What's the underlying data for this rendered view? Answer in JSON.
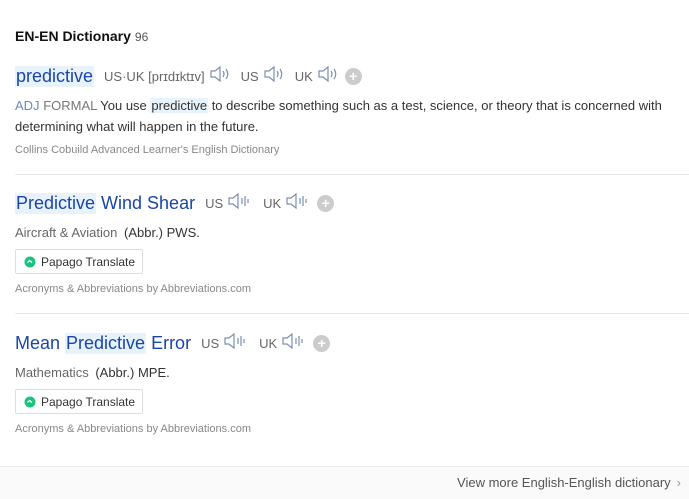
{
  "header": {
    "title": "EN-EN Dictionary",
    "count": "96"
  },
  "entries": [
    {
      "word": "predictive",
      "pron_label": "US·UK [prɪdɪktɪv]",
      "us_label": "US",
      "uk_label": "UK",
      "def_pos": "ADJ",
      "def_register": "FORMAL",
      "def_pre": "You use",
      "def_hl": "predictive",
      "def_post": "to describe something such as a test, science, or theory that is concerned with determining what will happen in the future.",
      "source": "Collins Cobuild Advanced Learner's English Dictionary"
    },
    {
      "word_hl": "Predictive",
      "word_rest": "Wind Shear",
      "us_label": "US",
      "uk_label": "UK",
      "domain": "Aircraft & Aviation",
      "meaning": "(Abbr.) PWS.",
      "translate": "Papago Translate",
      "source": "Acronyms & Abbreviations by Abbreviations.com"
    },
    {
      "word_pre": "Mean",
      "word_hl": "Predictive",
      "word_post": "Error",
      "us_label": "US",
      "uk_label": "UK",
      "domain": "Mathematics",
      "meaning": "(Abbr.) MPE.",
      "translate": "Papago Translate",
      "source": "Acronyms & Abbreviations by Abbreviations.com"
    }
  ],
  "footer": {
    "more_label": "View more English-English dictionary"
  },
  "icons": {
    "speaker": "speaker-icon",
    "add": "plus-circle-icon",
    "chevron": "chevron-right-icon",
    "papago": "papago-logo-icon"
  },
  "colors": {
    "link": "#1a46a8",
    "highlight": "#e7f2fb"
  }
}
